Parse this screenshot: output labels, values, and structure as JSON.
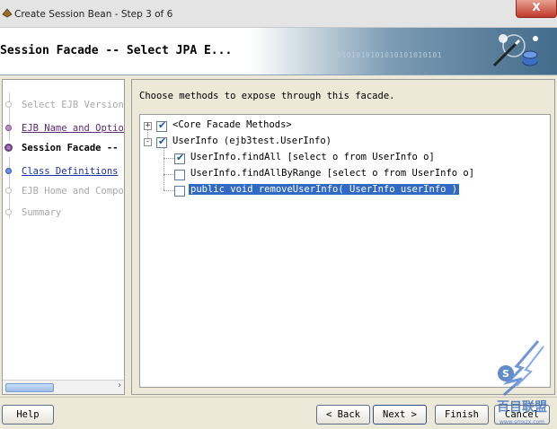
{
  "window": {
    "title": "Create Session Bean - Step 3 of 6",
    "close_label": "X"
  },
  "banner": {
    "heading": "Session Facade -- Select JPA E...",
    "binary_text": "0101010101010101010101"
  },
  "steps": [
    {
      "label": "Select EJB Version",
      "state": "disabled"
    },
    {
      "label": "EJB Name and Options",
      "state": "visited"
    },
    {
      "label": "Session Facade --",
      "state": "current"
    },
    {
      "label": "Class Definitions",
      "state": "link"
    },
    {
      "label": "EJB Home and Component",
      "state": "disabled"
    },
    {
      "label": "Summary",
      "state": "disabled"
    }
  ],
  "main": {
    "instruction": "Choose methods to expose through this facade.",
    "tree": [
      {
        "label": "<Core Facade Methods>",
        "checked": true,
        "expander": "+"
      },
      {
        "label": "UserInfo (ejb3test.UserInfo)",
        "checked": true,
        "expander": "-"
      },
      {
        "label": "UserInfo.findAll [select o from UserInfo o]",
        "checked": true
      },
      {
        "label": "UserInfo.findAllByRange [select o from UserInfo o]",
        "checked": false
      },
      {
        "label": "public void removeUserInfo( UserInfo userInfo )",
        "checked": false,
        "selected": true
      }
    ]
  },
  "buttons": {
    "help": "Help",
    "back": "< Back",
    "next": "Next >",
    "finish": "Finish",
    "cancel": "Cancel"
  },
  "watermark": {
    "text": "百目联盟",
    "subtext": "www.smxzx.com"
  }
}
